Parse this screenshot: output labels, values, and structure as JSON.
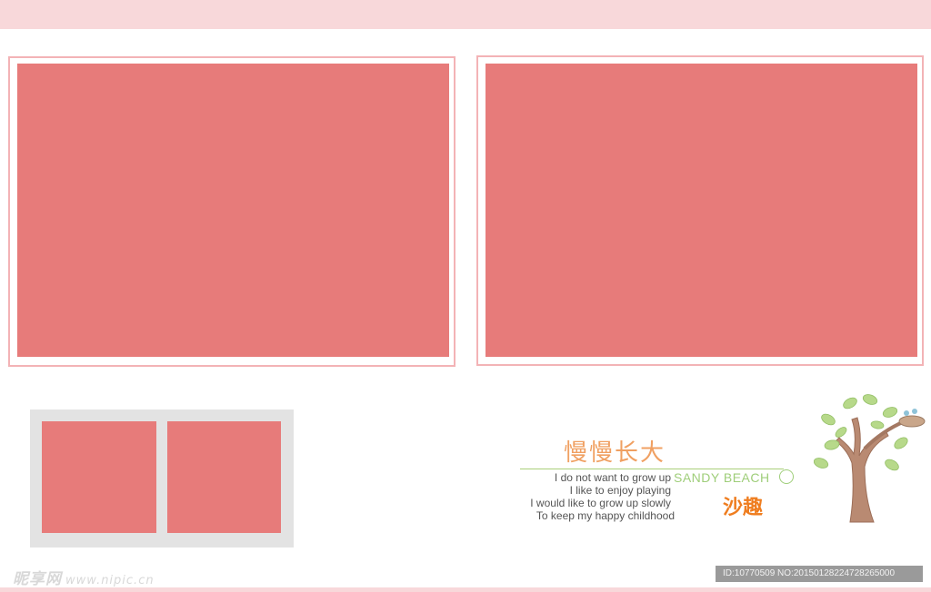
{
  "watermark": {
    "site_name": "昵享网",
    "url": "www.nipic.cn",
    "id_text": "ID:10770509 NO:20150128224728265000"
  },
  "caption": {
    "title_cn": "慢慢长大",
    "sandy_beach": "SANDY BEACH",
    "subtitle_cn": "沙趣",
    "poem_lines": [
      "I do not want to grow up",
      "I like to enjoy playing",
      "I would like to grow up slowly",
      "To keep my happy childhood"
    ]
  },
  "colors": {
    "placeholder": "#e77b7a",
    "frame_border": "#f3b3b6",
    "band": "#f8d8da",
    "accent_green": "#9fce7a",
    "accent_orange": "#ef7d1f"
  },
  "icons": [
    "tree-with-bird-nest-icon"
  ]
}
